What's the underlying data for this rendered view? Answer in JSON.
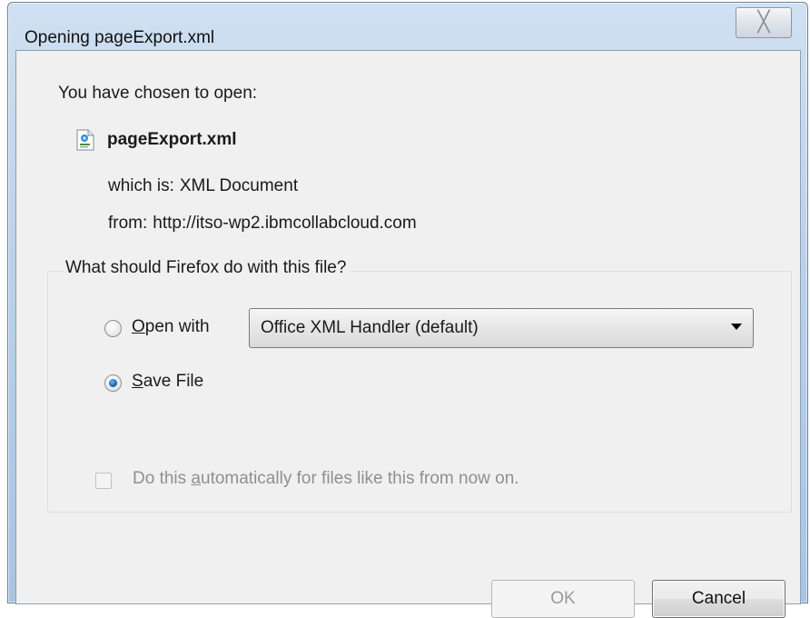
{
  "window": {
    "title": "Opening pageExport.xml",
    "close_glyph": "╳"
  },
  "dialog": {
    "header": "You have chosen to open:",
    "file": {
      "icon": "xml-file-icon",
      "name": "pageExport.xml"
    },
    "type_label": "which is:",
    "type_value": "XML Document",
    "from_label": "from:",
    "from_value": "http://itso-wp2.ibmcollabcloud.com"
  },
  "action_group": {
    "legend": "What should Firefox do with this file?",
    "open_with": {
      "accel": "O",
      "rest": "pen with",
      "selected": false
    },
    "handler_select": {
      "value": "Office XML Handler (default)"
    },
    "save_file": {
      "accel": "S",
      "rest": "ave File",
      "selected": true
    },
    "auto_checkbox": {
      "pre": "Do this ",
      "accel": "a",
      "post": "utomatically for files like this from now on.",
      "checked": false,
      "enabled": false
    }
  },
  "buttons": {
    "ok": "OK",
    "cancel": "Cancel"
  },
  "colors": {
    "frame": "#b9d1ea",
    "client": "#f0f0f0",
    "radio_selected": "#1c6ab8",
    "disabled_text": "#8f8f8f"
  }
}
